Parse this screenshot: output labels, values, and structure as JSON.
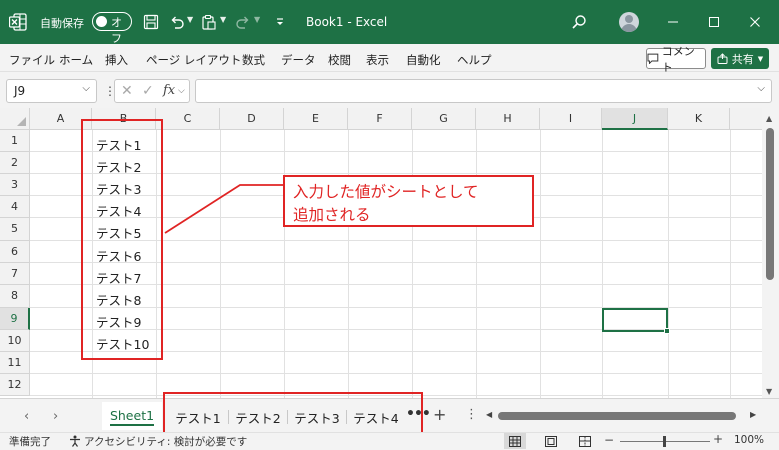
{
  "titlebar": {
    "autosave_label": "自動保存",
    "autosave_state": "オフ",
    "doc_title": "Book1  -  Excel",
    "logo_icon": "excel-logo-icon",
    "bg_color": "#1e7145"
  },
  "ribbon": {
    "tabs": [
      "ファイル",
      "ホーム",
      "挿入",
      "ページ レイアウト",
      "数式",
      "データ",
      "校閲",
      "表示",
      "自動化",
      "ヘルプ"
    ],
    "comment_label": "コメント",
    "share_label": "共有"
  },
  "formula_bar": {
    "name_box": "J9",
    "fx_label": "fx",
    "value": ""
  },
  "grid": {
    "columns": [
      "A",
      "B",
      "C",
      "D",
      "E",
      "F",
      "G",
      "H",
      "I",
      "J",
      "K"
    ],
    "rows": [
      "1",
      "2",
      "3",
      "4",
      "5",
      "6",
      "7",
      "8",
      "9",
      "10",
      "11",
      "12"
    ],
    "column_b_values": [
      "テスト1",
      "テスト2",
      "テスト3",
      "テスト4",
      "テスト5",
      "テスト6",
      "テスト7",
      "テスト8",
      "テスト9",
      "テスト10"
    ],
    "selected_cell": "J9"
  },
  "annotation": {
    "line1": "入力した値がシートとして",
    "line2": "追加される",
    "color": "#e02424"
  },
  "sheet_tabs": {
    "tabs": [
      "Sheet1",
      "テスト1",
      "テスト2",
      "テスト3",
      "テスト4"
    ],
    "active": "Sheet1",
    "more_label": "•••"
  },
  "statusbar": {
    "ready": "準備完了",
    "accessibility": "アクセシビリティ: 検討が必要です",
    "zoom": "100%"
  }
}
